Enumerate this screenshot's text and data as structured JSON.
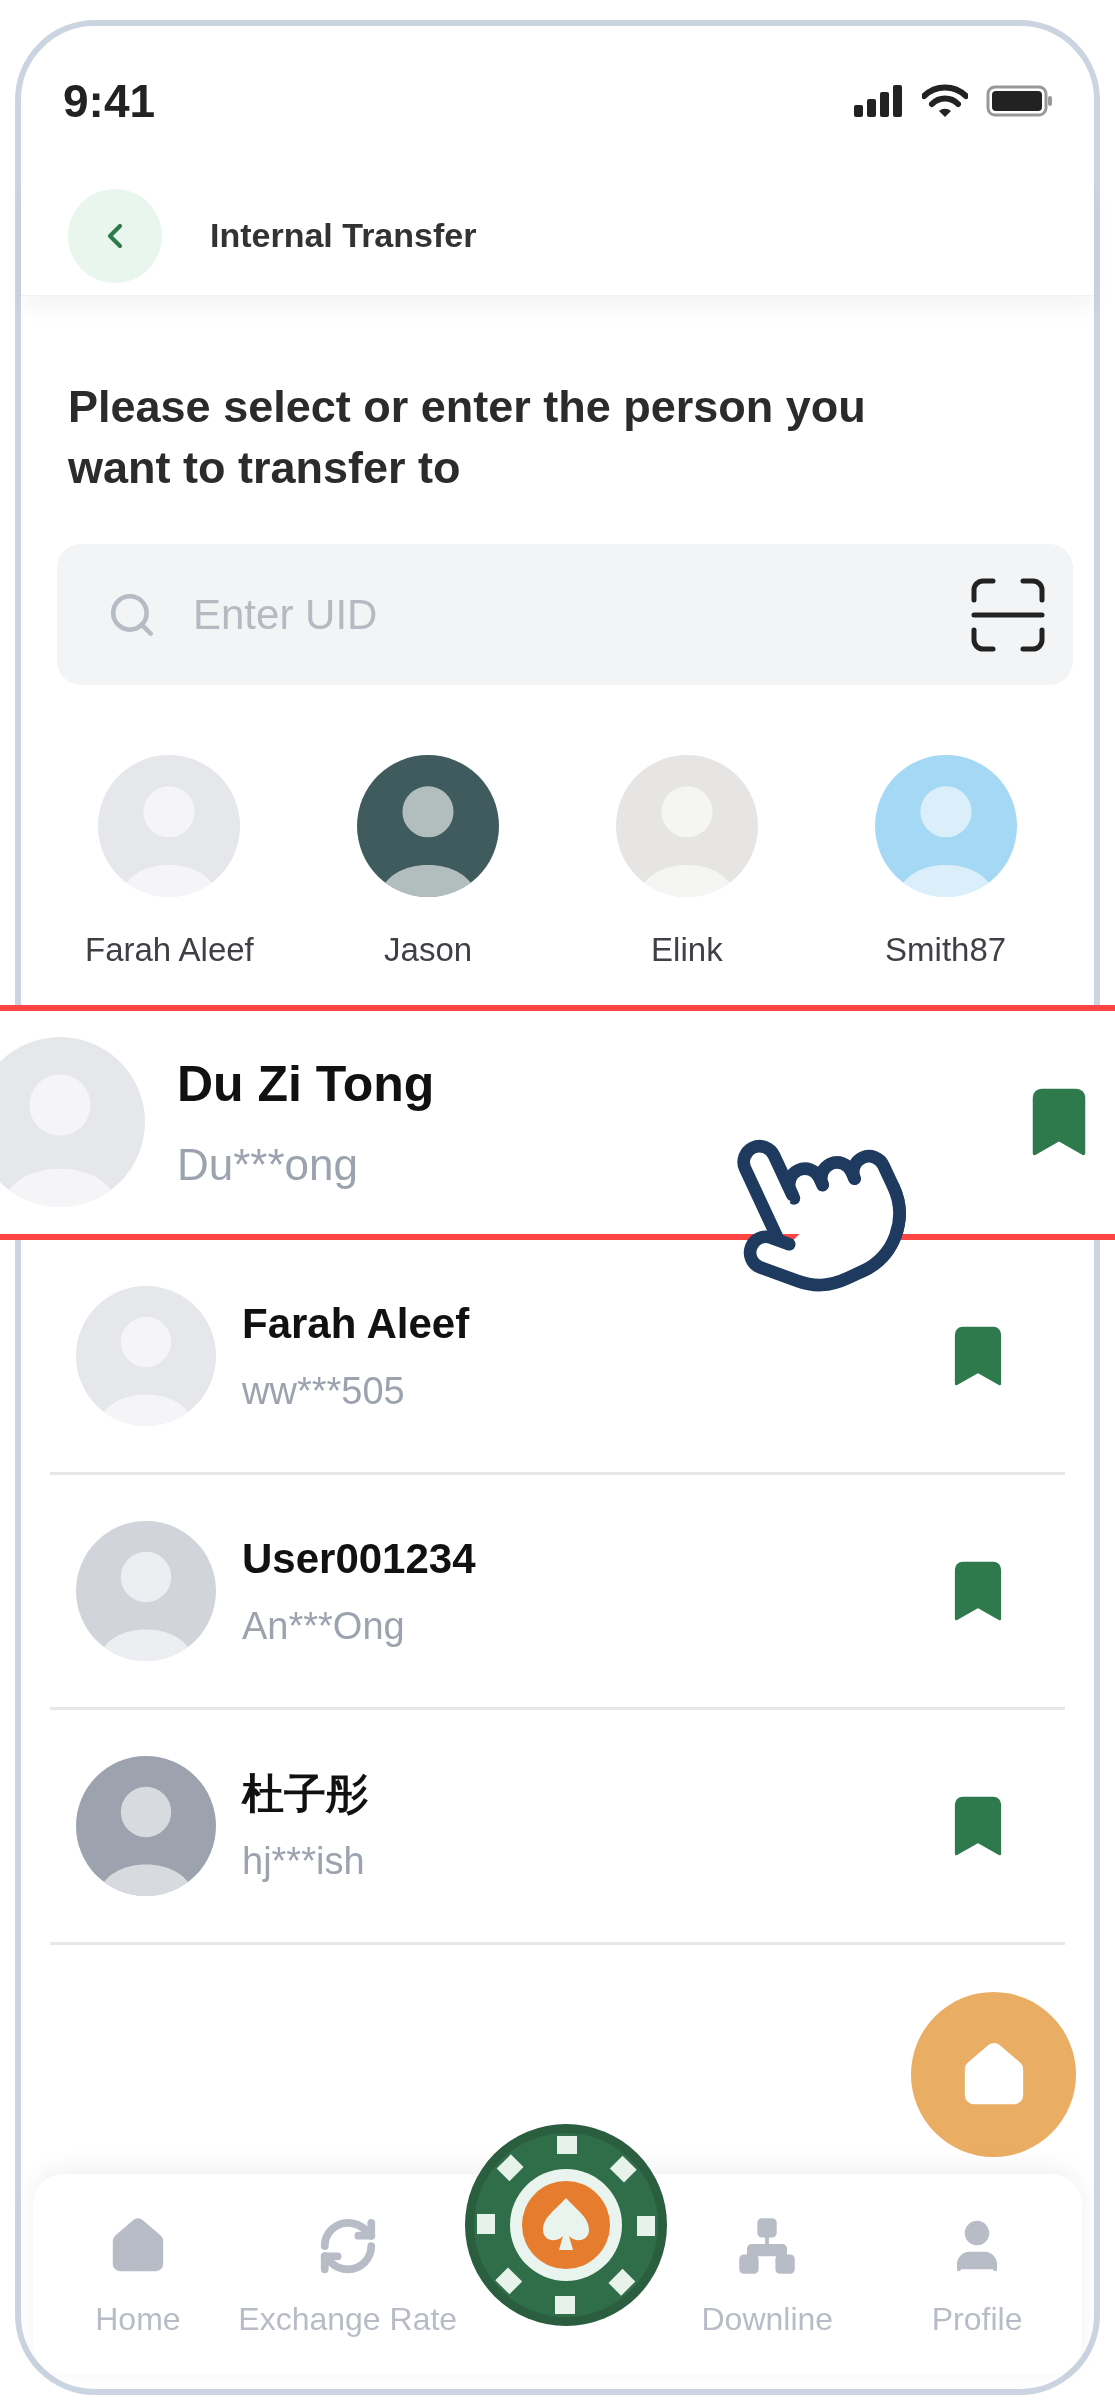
{
  "status_bar": {
    "time": "9:41"
  },
  "header": {
    "title": "Internal Transfer"
  },
  "prompt": "Please select or enter the person you want to transfer to",
  "search": {
    "placeholder": "Enter UID"
  },
  "recent": [
    {
      "name": "Farah Aleef"
    },
    {
      "name": "Jason"
    },
    {
      "name": "Elink"
    },
    {
      "name": "Smith87"
    }
  ],
  "highlighted": {
    "name": "Du Zi Tong",
    "uid": "Du***ong"
  },
  "contacts": [
    {
      "name": "Farah Aleef",
      "uid": "ww***505"
    },
    {
      "name": "User001234",
      "uid": "An***Ong"
    },
    {
      "name": "杜子彤",
      "uid": "hj***ish"
    }
  ],
  "nav": [
    {
      "label": "Home"
    },
    {
      "label": "Exchange Rate"
    },
    {
      "label": "Downline"
    },
    {
      "label": "Profile"
    }
  ]
}
